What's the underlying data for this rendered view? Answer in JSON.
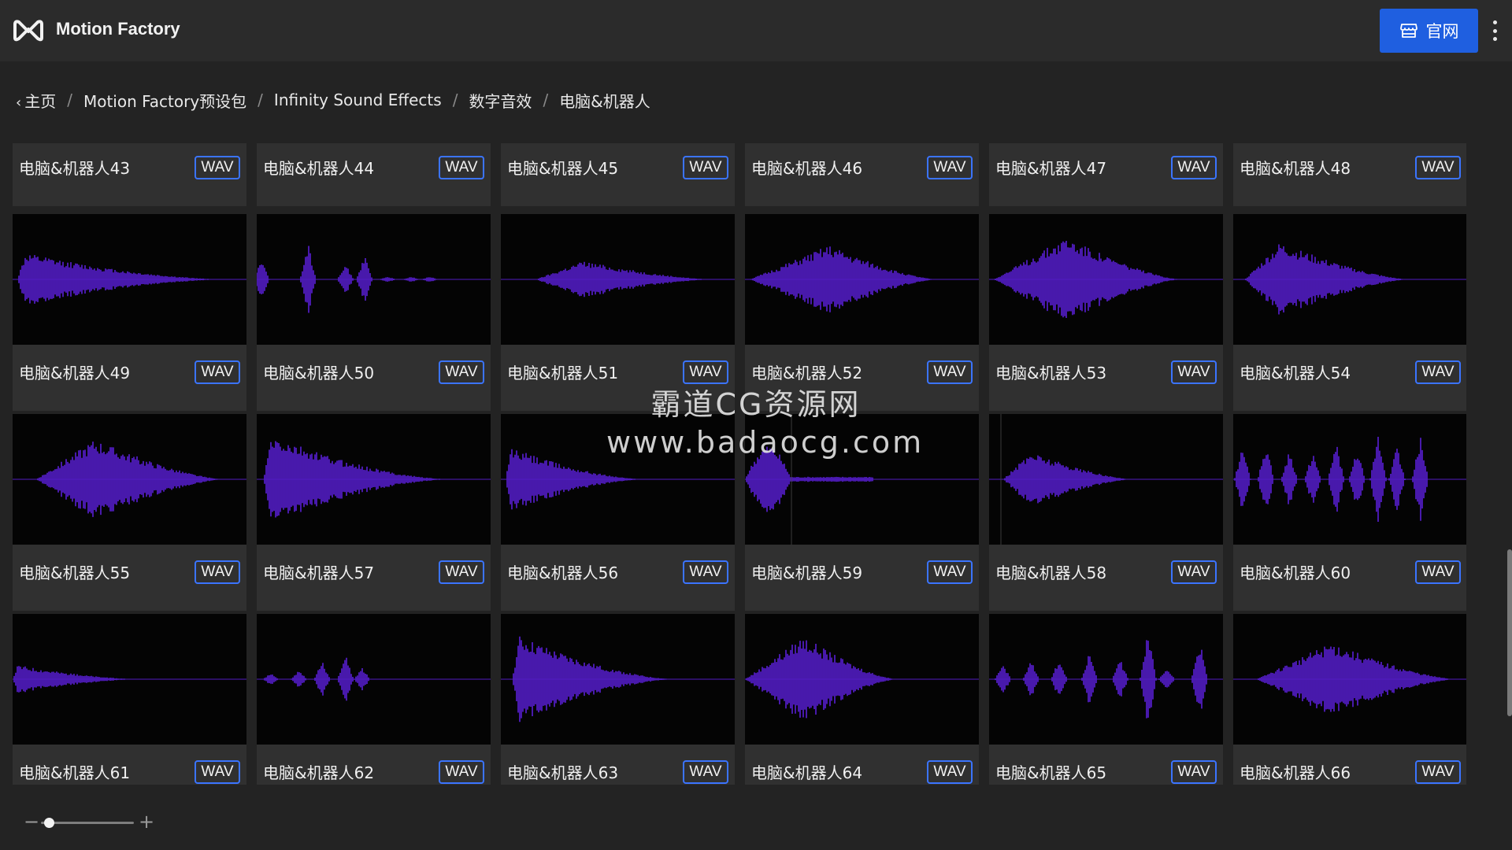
{
  "header": {
    "app_title": "Motion Factory",
    "logo_icon": "motion-factory-logo-icon",
    "site_button_label": "官网",
    "site_button_icon": "storefront-icon",
    "menu_icon": "kebab-menu-icon",
    "accent_color": "#1f5fe0"
  },
  "breadcrumb": {
    "back_icon": "chevron-left-icon",
    "items": [
      "主页",
      "Motion Factory预设包",
      "Infinity Sound Effects",
      "数字音效",
      "电脑&机器人"
    ]
  },
  "grid": {
    "waveform_color": "#5a1fd6",
    "badge_border_color": "#3b74ff",
    "partial_row": [
      {
        "name": "电脑&机器人43",
        "format": "WAV"
      },
      {
        "name": "电脑&机器人44",
        "format": "WAV"
      },
      {
        "name": "电脑&机器人45",
        "format": "WAV"
      },
      {
        "name": "电脑&机器人46",
        "format": "WAV"
      },
      {
        "name": "电脑&机器人47",
        "format": "WAV"
      },
      {
        "name": "电脑&机器人48",
        "format": "WAV"
      }
    ],
    "rows": [
      [
        {
          "name": "电脑&机器人49",
          "format": "WAV"
        },
        {
          "name": "电脑&机器人50",
          "format": "WAV"
        },
        {
          "name": "电脑&机器人51",
          "format": "WAV"
        },
        {
          "name": "电脑&机器人52",
          "format": "WAV"
        },
        {
          "name": "电脑&机器人53",
          "format": "WAV"
        },
        {
          "name": "电脑&机器人54",
          "format": "WAV"
        }
      ],
      [
        {
          "name": "电脑&机器人55",
          "format": "WAV"
        },
        {
          "name": "电脑&机器人57",
          "format": "WAV"
        },
        {
          "name": "电脑&机器人56",
          "format": "WAV"
        },
        {
          "name": "电脑&机器人59",
          "format": "WAV"
        },
        {
          "name": "电脑&机器人58",
          "format": "WAV"
        },
        {
          "name": "电脑&机器人60",
          "format": "WAV"
        }
      ],
      [
        {
          "name": "电脑&机器人61",
          "format": "WAV"
        },
        {
          "name": "电脑&机器人62",
          "format": "WAV"
        },
        {
          "name": "电脑&机器人63",
          "format": "WAV"
        },
        {
          "name": "电脑&机器人64",
          "format": "WAV"
        },
        {
          "name": "电脑&机器人65",
          "format": "WAV"
        },
        {
          "name": "电脑&机器人66",
          "format": "WAV"
        }
      ]
    ]
  },
  "watermark": {
    "line1": "霸道CG资源网",
    "line2": "www.badaocg.com"
  },
  "zoom": {
    "minus_label": "−",
    "plus_label": "+",
    "level": 0.05
  }
}
